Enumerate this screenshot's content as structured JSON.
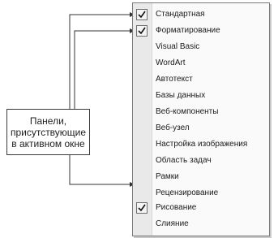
{
  "menu": {
    "items": [
      {
        "label": "Стандартная",
        "checked": true
      },
      {
        "label": "Форматирование",
        "checked": true
      },
      {
        "label": "Visual Basic",
        "checked": false
      },
      {
        "label": "WordArt",
        "checked": false
      },
      {
        "label": "Автотекст",
        "checked": false
      },
      {
        "label": "Базы данных",
        "checked": false
      },
      {
        "label": "Веб-компоненты",
        "checked": false
      },
      {
        "label": "Веб-узел",
        "checked": false
      },
      {
        "label": "Настройка изображения",
        "checked": false
      },
      {
        "label": "Область задач",
        "checked": false
      },
      {
        "label": "Рамки",
        "checked": false
      },
      {
        "label": "Рецензирование",
        "checked": false
      },
      {
        "label": "Рисование",
        "checked": true
      },
      {
        "label": "Слияние",
        "checked": false
      }
    ]
  },
  "callout": {
    "lines": [
      "Панели,",
      "присутствующие",
      "в активном окне"
    ]
  }
}
